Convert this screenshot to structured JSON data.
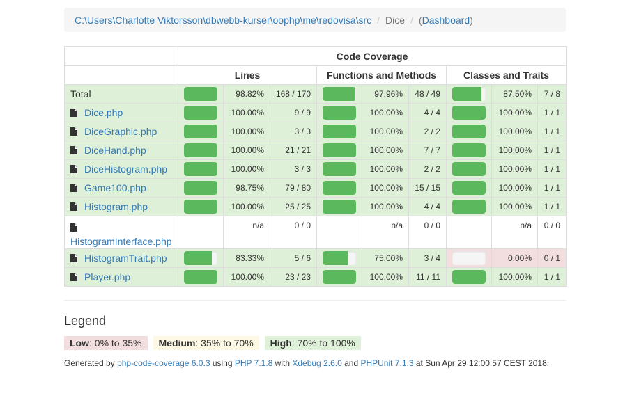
{
  "breadcrumb": {
    "path": "C:\\Users\\Charlotte Viktorsson\\dbwebb-kurser\\oophp\\me\\redovisa\\src",
    "current": "Dice",
    "open_paren": "(",
    "dashboard": "Dashboard",
    "close_paren": ")"
  },
  "table": {
    "title": "Code Coverage",
    "groups": [
      "Lines",
      "Functions and Methods",
      "Classes and Traits"
    ],
    "rows": [
      {
        "name": "Total",
        "lines_pct": "98.82%",
        "lines_count": "168 / 170",
        "lines_fill": 98.82,
        "fn_pct": "97.96%",
        "fn_count": "48 / 49",
        "fn_fill": 97.96,
        "cls_pct": "87.50%",
        "cls_count": "7 / 8",
        "cls_fill": 87.5
      },
      {
        "name": "Dice.php",
        "lines_pct": "100.00%",
        "lines_count": "9 / 9",
        "lines_fill": 100,
        "fn_pct": "100.00%",
        "fn_count": "4 / 4",
        "fn_fill": 100,
        "cls_pct": "100.00%",
        "cls_count": "1 / 1",
        "cls_fill": 100
      },
      {
        "name": "DiceGraphic.php",
        "lines_pct": "100.00%",
        "lines_count": "3 / 3",
        "lines_fill": 100,
        "fn_pct": "100.00%",
        "fn_count": "2 / 2",
        "fn_fill": 100,
        "cls_pct": "100.00%",
        "cls_count": "1 / 1",
        "cls_fill": 100
      },
      {
        "name": "DiceHand.php",
        "lines_pct": "100.00%",
        "lines_count": "21 / 21",
        "lines_fill": 100,
        "fn_pct": "100.00%",
        "fn_count": "7 / 7",
        "fn_fill": 100,
        "cls_pct": "100.00%",
        "cls_count": "1 / 1",
        "cls_fill": 100
      },
      {
        "name": "DiceHistogram.php",
        "lines_pct": "100.00%",
        "lines_count": "3 / 3",
        "lines_fill": 100,
        "fn_pct": "100.00%",
        "fn_count": "2 / 2",
        "fn_fill": 100,
        "cls_pct": "100.00%",
        "cls_count": "1 / 1",
        "cls_fill": 100
      },
      {
        "name": "Game100.php",
        "lines_pct": "98.75%",
        "lines_count": "79 / 80",
        "lines_fill": 98.75,
        "fn_pct": "100.00%",
        "fn_count": "15 / 15",
        "fn_fill": 100,
        "cls_pct": "100.00%",
        "cls_count": "1 / 1",
        "cls_fill": 100
      },
      {
        "name": "Histogram.php",
        "lines_pct": "100.00%",
        "lines_count": "25 / 25",
        "lines_fill": 100,
        "fn_pct": "100.00%",
        "fn_count": "4 / 4",
        "fn_fill": 100,
        "cls_pct": "100.00%",
        "cls_count": "1 / 1",
        "cls_fill": 100
      },
      {
        "name": "HistogramInterface.php",
        "lines_pct": "n/a",
        "lines_count": "0 / 0",
        "fn_pct": "n/a",
        "fn_count": "0 / 0",
        "cls_pct": "n/a",
        "cls_count": "0 / 0"
      },
      {
        "name": "HistogramTrait.php",
        "lines_pct": "83.33%",
        "lines_count": "5 / 6",
        "lines_fill": 83.33,
        "fn_pct": "75.00%",
        "fn_count": "3 / 4",
        "fn_fill": 75,
        "cls_pct": "0.00%",
        "cls_count": "0 / 1",
        "cls_fill": 0
      },
      {
        "name": "Player.php",
        "lines_pct": "100.00%",
        "lines_count": "23 / 23",
        "lines_fill": 100,
        "fn_pct": "100.00%",
        "fn_count": "11 / 11",
        "fn_fill": 100,
        "cls_pct": "100.00%",
        "cls_count": "1 / 1",
        "cls_fill": 100
      }
    ]
  },
  "legend": {
    "title": "Legend",
    "low_label": "Low",
    "low_range": ": 0% to 35%",
    "medium_label": "Medium",
    "medium_range": ": 35% to 70%",
    "high_label": "High",
    "high_range": ": 70% to 100%"
  },
  "generated": {
    "prefix": "Generated by ",
    "tool": "php-code-coverage 6.0.3",
    "using": " using ",
    "php": "PHP 7.1.8",
    "with": " with ",
    "xdebug": "Xdebug 2.6.0",
    "and": " and ",
    "phpunit": "PHPUnit 7.1.3",
    "suffix": " at Sun Apr 29 12:00:57 CEST 2018."
  },
  "colors": {
    "success_bg": "#dff0d8",
    "danger_bg": "#f2dede",
    "warning_bg": "#fcf8e3",
    "bar_fill": "#5cb85c",
    "link": "#337ab7"
  }
}
